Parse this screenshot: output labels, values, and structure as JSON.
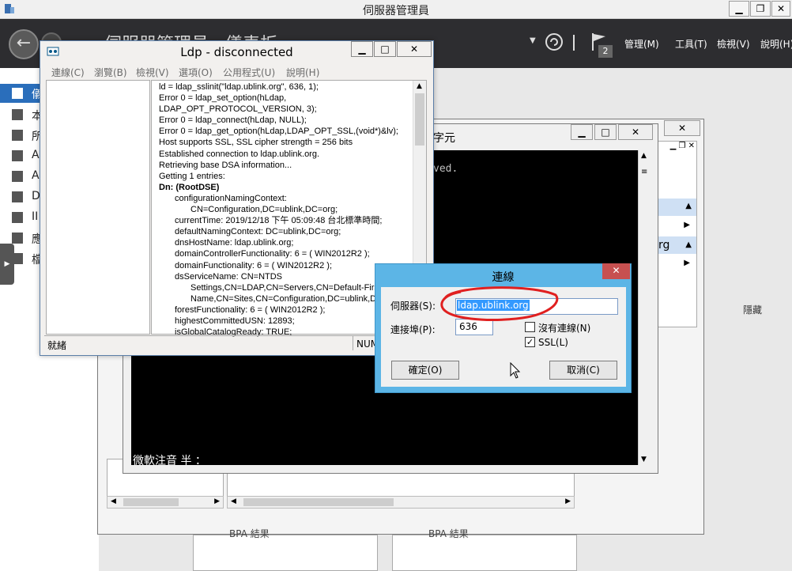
{
  "server_manager": {
    "window_title": "伺服器管理員",
    "breadcrumb": "伺服器管理員 · 儀表板",
    "notification_count": "2",
    "menus": [
      "管理(M)",
      "工具(T)",
      "檢視(V)",
      "說明(H)"
    ],
    "nav_items": [
      "儀",
      "本",
      "所",
      "A",
      "A",
      "D",
      "II",
      "應",
      "檔"
    ],
    "hidden_label": "隱藏",
    "bpa_label": "BPA 結果",
    "right_panel_text": "rg"
  },
  "console": {
    "title": "字元",
    "saved_text": "ved.",
    "ime_text": "微軟注音 半 ："
  },
  "ldp": {
    "title": "Ldp - disconnected",
    "menus": [
      "連線(C)",
      "瀏覽(B)",
      "檢視(V)",
      "選項(O)",
      "公用程式(U)",
      "說明(H)"
    ],
    "output_lines": [
      {
        "text": "ld = ldap_sslinit(\"ldap.ublink.org\", 636, 1);",
        "indent": 0,
        "bold": false
      },
      {
        "text": "Error 0 = ldap_set_option(hLdap,",
        "indent": 0,
        "bold": false
      },
      {
        "text": "LDAP_OPT_PROTOCOL_VERSION, 3);",
        "indent": 0,
        "bold": false
      },
      {
        "text": "Error 0 = ldap_connect(hLdap, NULL);",
        "indent": 0,
        "bold": false
      },
      {
        "text": "Error 0 = ldap_get_option(hLdap,LDAP_OPT_SSL,(void*)&lv);",
        "indent": 0,
        "bold": false
      },
      {
        "text": "Host supports SSL, SSL cipher strength = 256 bits",
        "indent": 0,
        "bold": false
      },
      {
        "text": "Established connection to ldap.ublink.org.",
        "indent": 0,
        "bold": false
      },
      {
        "text": "Retrieving base DSA information...",
        "indent": 0,
        "bold": false
      },
      {
        "text": "Getting 1 entries:",
        "indent": 0,
        "bold": false
      },
      {
        "text": "Dn: (RootDSE)",
        "indent": 0,
        "bold": true
      },
      {
        "text": "configurationNamingContext:",
        "indent": 1,
        "bold": false
      },
      {
        "text": "CN=Configuration,DC=ublink,DC=org;",
        "indent": 2,
        "bold": false
      },
      {
        "text": "currentTime: 2019/12/18 下午 05:09:48 台北標準時間;",
        "indent": 1,
        "bold": false
      },
      {
        "text": "defaultNamingContext: DC=ublink,DC=org;",
        "indent": 1,
        "bold": false
      },
      {
        "text": "dnsHostName: ldap.ublink.org;",
        "indent": 1,
        "bold": false
      },
      {
        "text": "domainControllerFunctionality: 6 = ( WIN2012R2 );",
        "indent": 1,
        "bold": false
      },
      {
        "text": "domainFunctionality: 6 = ( WIN2012R2 );",
        "indent": 1,
        "bold": false
      },
      {
        "text": "dsServiceName: CN=NTDS",
        "indent": 1,
        "bold": false
      },
      {
        "text": "Settings,CN=LDAP,CN=Servers,CN=Default-First-",
        "indent": 2,
        "bold": false
      },
      {
        "text": "Name,CN=Sites,CN=Configuration,DC=ublink,DC=",
        "indent": 2,
        "bold": false
      },
      {
        "text": "forestFunctionality: 6 = ( WIN2012R2 );",
        "indent": 1,
        "bold": false
      },
      {
        "text": "highestCommittedUSN: 12893;",
        "indent": 1,
        "bold": false
      },
      {
        "text": "isGlobalCatalogReady: TRUE;",
        "indent": 1,
        "bold": false
      }
    ],
    "status_left": "就緒",
    "status_right": "NUM"
  },
  "connect_dialog": {
    "title": "連線",
    "server_label": "伺服器(S):",
    "server_value": "ldap.ublink.org",
    "port_label": "連接埠(P):",
    "port_value": "636",
    "connectionless_label": "沒有連線(N)",
    "connectionless_checked": false,
    "ssl_label": "SSL(L)",
    "ssl_checked": true,
    "ok_label": "確定(O)",
    "cancel_label": "取消(C)",
    "highlight_color": "#e02020"
  }
}
